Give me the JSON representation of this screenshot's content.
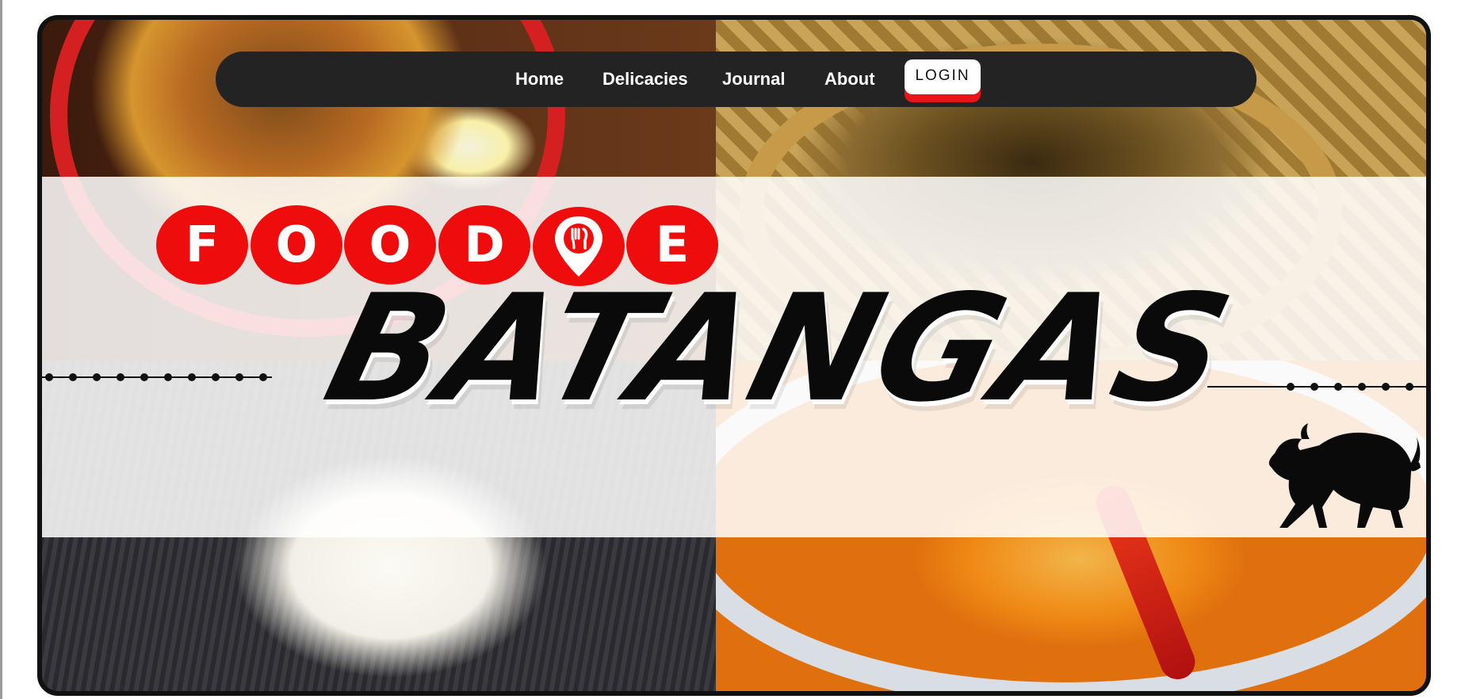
{
  "nav": {
    "items": [
      {
        "label": "Home"
      },
      {
        "label": "Delicacies"
      },
      {
        "label": "Journal"
      },
      {
        "label": "About"
      }
    ],
    "login_label": "LOGIN"
  },
  "hero": {
    "logo_letters": [
      "F",
      "O",
      "O",
      "D",
      "E"
    ],
    "logo_icon": "map-pin-utensils-icon",
    "title": "BATANGAS",
    "emblem_icon": "bull-icon",
    "background_photos": [
      "noodle-soup-bowl",
      "coffee-beans-basket",
      "rice-dish",
      "orange-stew-with-chili"
    ]
  },
  "colors": {
    "brand_red": "#ef0c0c",
    "nav_bg": "#232323",
    "login_accent": "#e8141a",
    "frame_border": "#111111"
  }
}
